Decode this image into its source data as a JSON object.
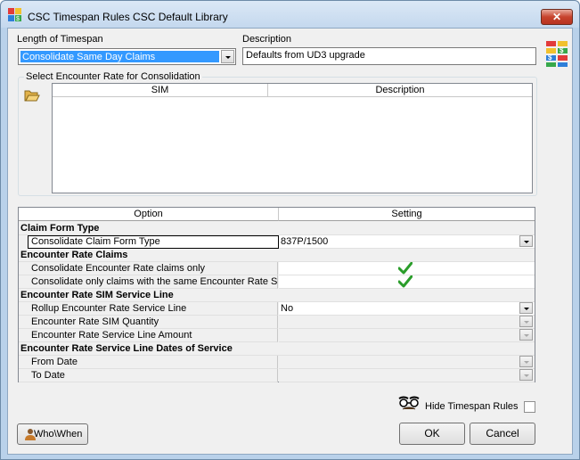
{
  "window": {
    "title": "CSC Timespan Rules  CSC Default Library",
    "close_label": "✕"
  },
  "length_of_timespan": {
    "label": "Length of Timespan",
    "value": "Consolidate Same Day Claims"
  },
  "description": {
    "label": "Description",
    "value": "Defaults from UD3 upgrade"
  },
  "encounter_rate": {
    "group_title": "Select Encounter Rate for Consolidation",
    "columns": [
      "SIM",
      "Description"
    ]
  },
  "grid": {
    "columns": [
      "Option",
      "Setting"
    ],
    "rows": [
      {
        "kind": "category",
        "option": "Claim Form Type"
      },
      {
        "kind": "item",
        "option": "Consolidate Claim Form Type",
        "setting": "837P/1500",
        "control": "dropdown",
        "enabled": true,
        "focused": true
      },
      {
        "kind": "category",
        "option": "Encounter Rate Claims"
      },
      {
        "kind": "item",
        "option": "Consolidate Encounter Rate claims  only",
        "setting": "",
        "control": "check",
        "checked": true,
        "enabled": true
      },
      {
        "kind": "item",
        "option": "Consolidate only claims with the same Encounter Rate SIM",
        "setting": "",
        "control": "check",
        "checked": true,
        "enabled": true
      },
      {
        "kind": "category",
        "option": "Encounter Rate SIM Service Line"
      },
      {
        "kind": "item",
        "option": "Rollup Encounter Rate Service Line",
        "setting": "No",
        "control": "dropdown",
        "enabled": true
      },
      {
        "kind": "item",
        "option": "Encounter Rate SIM Quantity",
        "setting": "",
        "control": "dropdown",
        "enabled": false
      },
      {
        "kind": "item",
        "option": "Encounter Rate Service Line Amount",
        "setting": "",
        "control": "dropdown",
        "enabled": false
      },
      {
        "kind": "category",
        "option": "Encounter Rate Service Line Dates of Service"
      },
      {
        "kind": "item",
        "option": "From Date",
        "setting": "",
        "control": "dropdown",
        "enabled": false
      },
      {
        "kind": "item",
        "option": "To Date",
        "setting": "",
        "control": "dropdown",
        "enabled": false
      }
    ]
  },
  "hide_timespan": {
    "label": "Hide Timespan Rules",
    "checked": false
  },
  "buttons": {
    "who_when": "Who\\When",
    "ok": "OK",
    "cancel": "Cancel"
  },
  "icons": {
    "app": "rules-app-icon",
    "rules": "colored-rules-icon",
    "folder": "open-folder-icon",
    "glasses": "disguise-glasses-icon",
    "check": "green-checkmark-icon",
    "whowhen": "person-icon"
  },
  "colors": {
    "selection": "#3399ff",
    "check": "#2a9d2a",
    "window_frame": "#b9d1ea"
  }
}
